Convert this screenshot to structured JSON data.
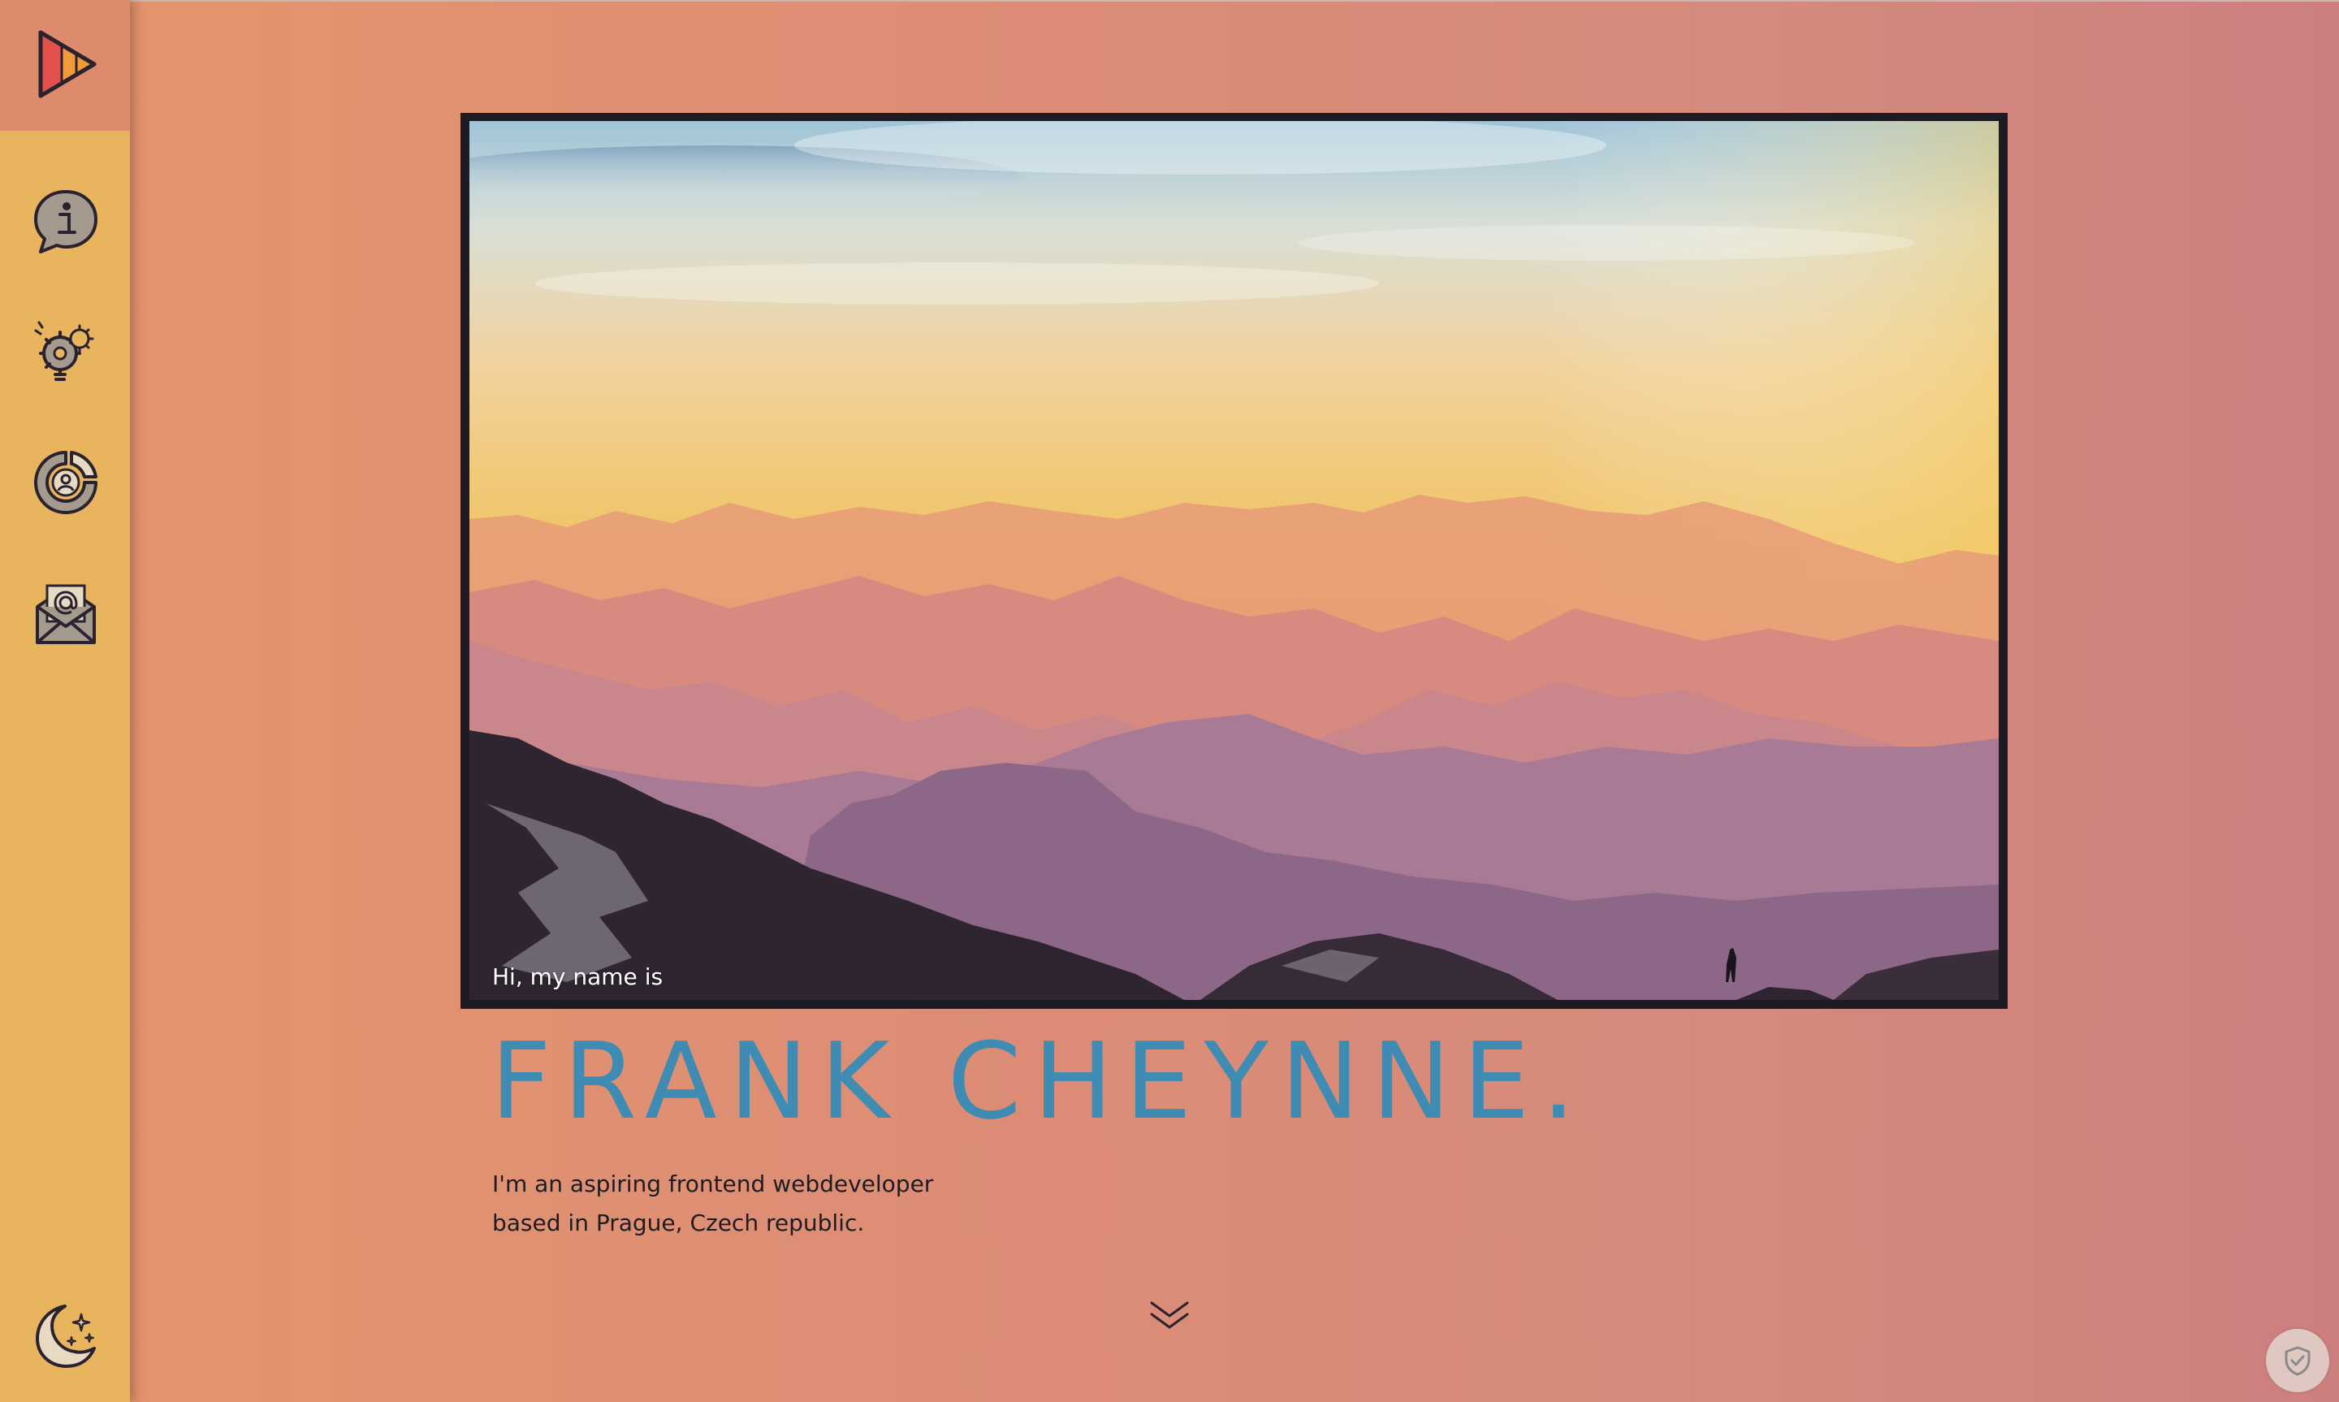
{
  "sidebar": {
    "logo_icon": "play-triangle-logo-icon",
    "items": [
      {
        "icon": "info-chat-icon",
        "label": "About"
      },
      {
        "icon": "lightbulb-gears-icon",
        "label": "Skills"
      },
      {
        "icon": "user-target-icon",
        "label": "Profile"
      },
      {
        "icon": "envelope-at-icon",
        "label": "Contact"
      }
    ],
    "theme_toggle_icon": "moon-stars-icon"
  },
  "hero": {
    "caption": "Hi, my name is",
    "name": "FRANK CHEYNNE.",
    "intro_line1": "I'm an aspiring frontend webdeveloper",
    "intro_line2": "based in Prague, Czech republic.",
    "scroll_icon": "double-chevron-down-icon"
  },
  "privacy_badge_icon": "shield-check-icon",
  "colors": {
    "sidebar": "#e8b55e",
    "logo_bg": "#dc8c6c",
    "name": "#3e8bb3",
    "frame": "#1d1b24"
  }
}
